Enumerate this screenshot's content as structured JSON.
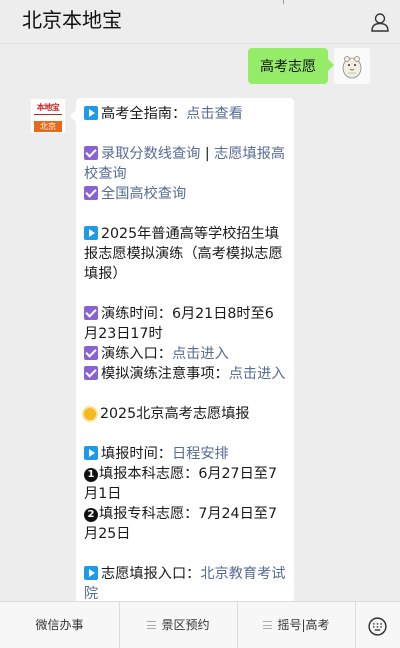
{
  "header": {
    "title": "北京本地宝",
    "profile_icon": "person-icon"
  },
  "chat": {
    "user_message": "高考志愿",
    "bot_avatar": {
      "top_text": "本地宝",
      "bottom_text": "北京"
    },
    "bot_message": {
      "guide_label": "高考全指南：",
      "guide_link": "点击查看",
      "score_link": "录取分数线查询",
      "sep": " | ",
      "fill_link": "志愿填报高校查询",
      "national_link": "全国高校查询",
      "sim_title": "2025年普通高等学校招生填报志愿模拟演练（高考模拟志愿填报）",
      "practice_time": "演练时间：6月21日8时至6月23日17时",
      "practice_entry_label": "演练入口：",
      "practice_entry_link": "点击进入",
      "practice_notes_label": "模拟演练注意事项：",
      "practice_notes_link": "点击进入",
      "section_title": "2025北京高考志愿填报",
      "fill_time_label": "填报时间：",
      "fill_time_link": "日程安排",
      "item1_num": "1",
      "item1": "填报本科志愿：6月27日至7月1日",
      "item2_num": "2",
      "item2": "填报专科志愿：7月24日至7月25日",
      "entry_label": "志愿填报入口：",
      "entry_link": "北京教育考试院"
    }
  },
  "bottom_bar": {
    "tab1": "微信办事",
    "tab2": "景区预约",
    "tab3": "摇号|高考",
    "keyboard_icon": "keyboard-icon"
  },
  "colors": {
    "user_bubble": "#95ec69",
    "link": "#576b95",
    "play_icon": "#1e9be8",
    "check_icon": "#8a63d2"
  }
}
